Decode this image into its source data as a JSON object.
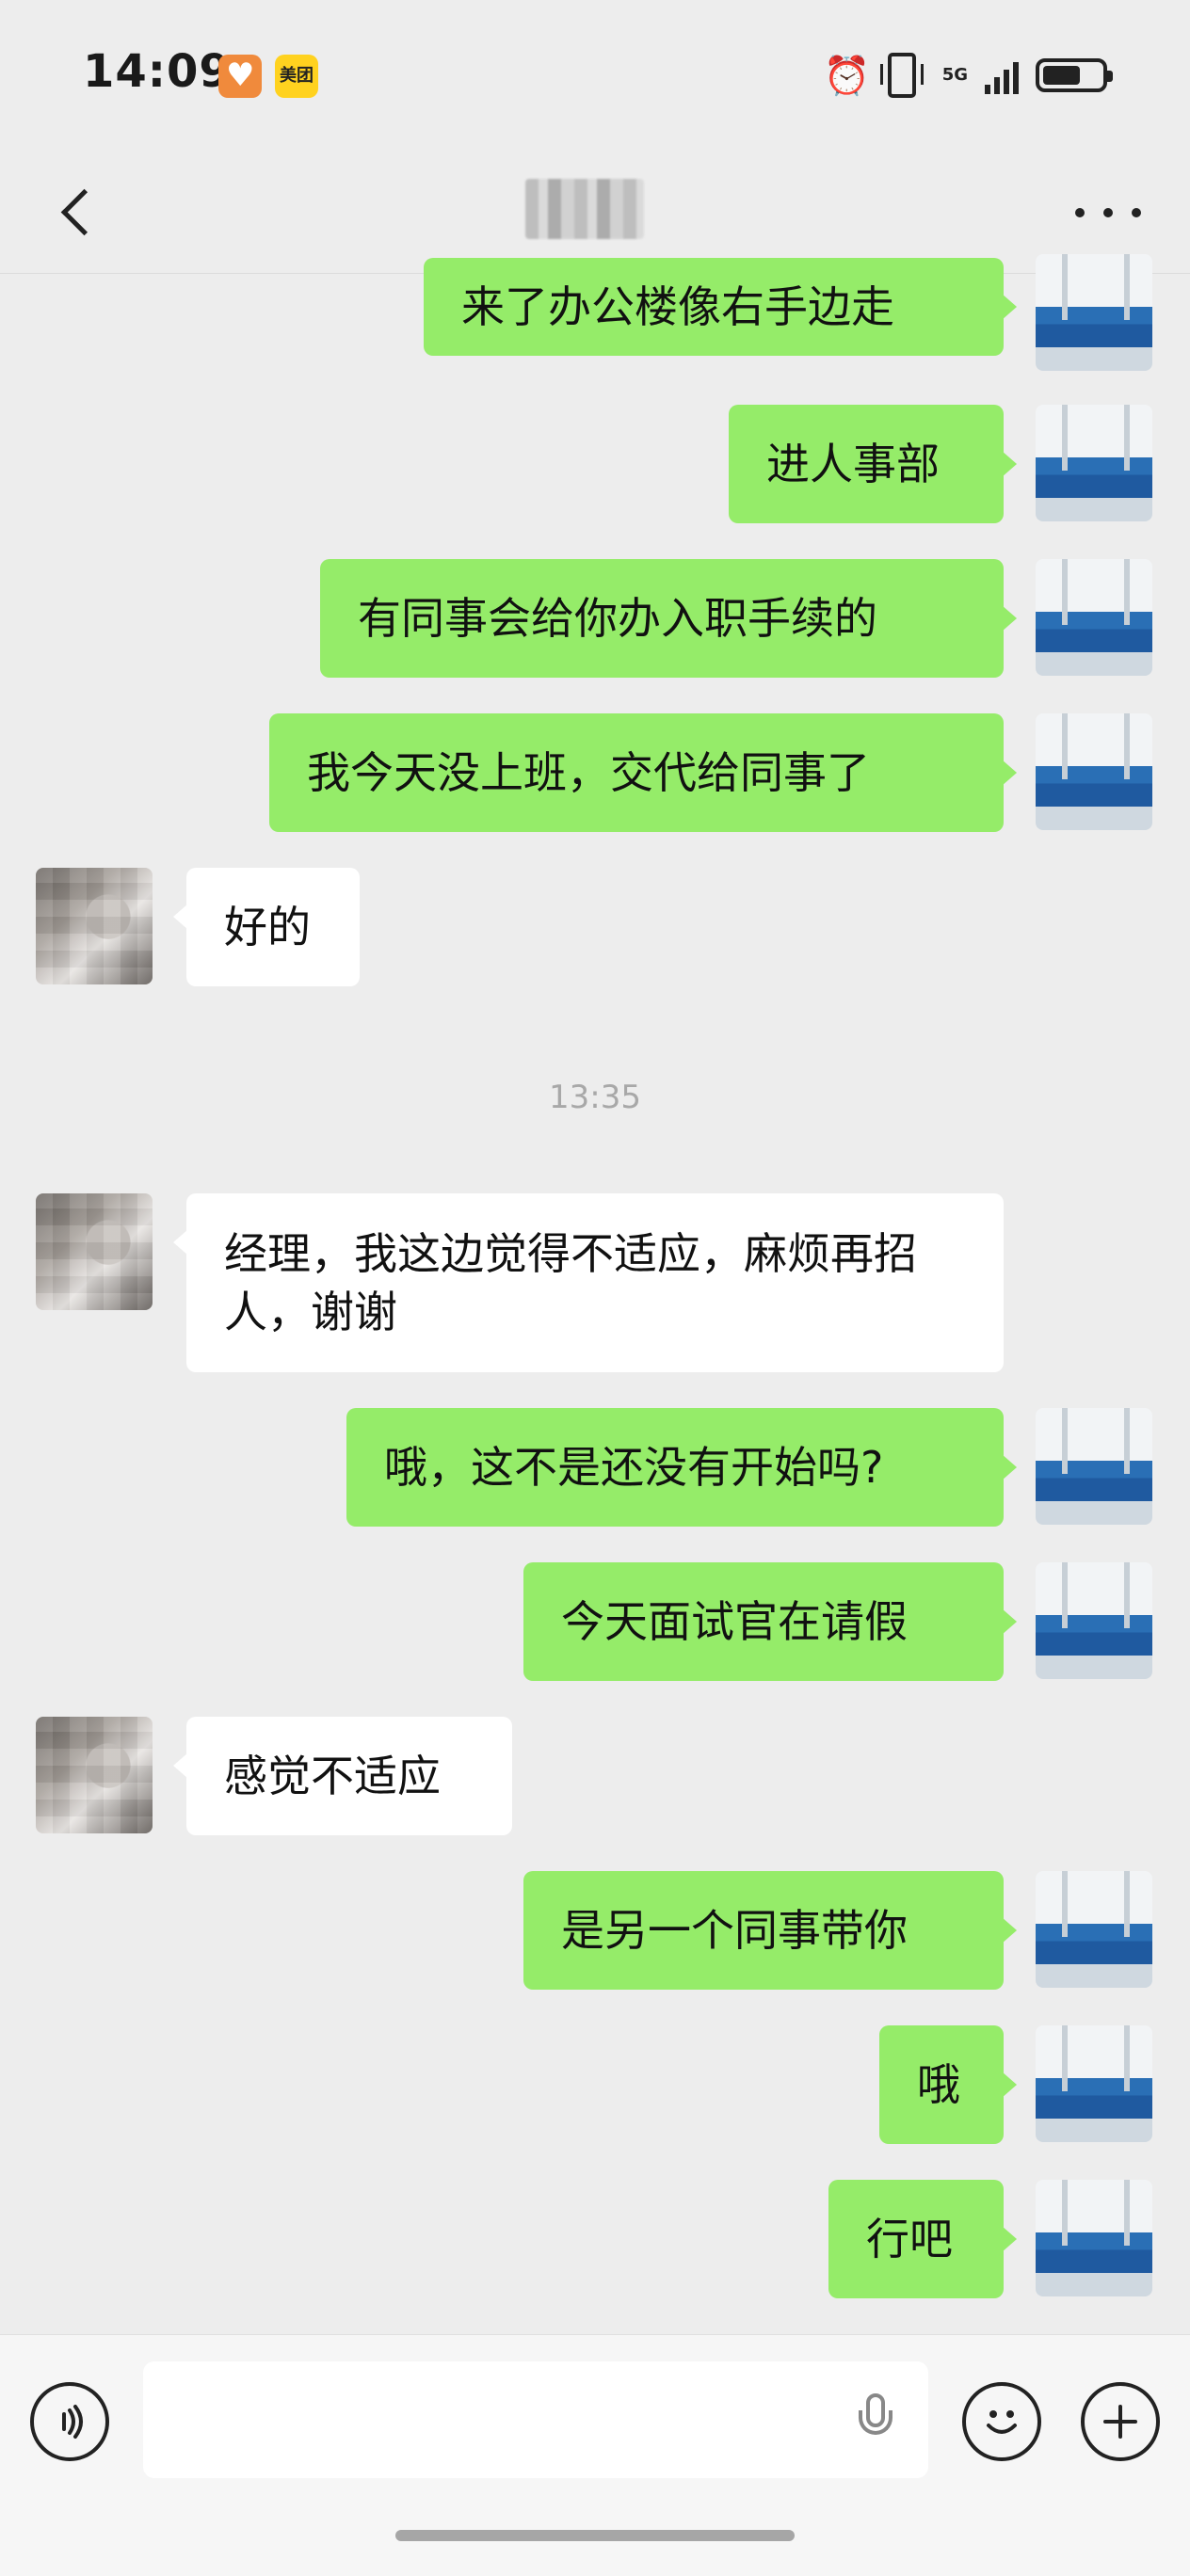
{
  "status_bar": {
    "time": "14:09",
    "meituan_label": "美团",
    "network": "5G"
  },
  "header": {
    "title_obscured": "张**"
  },
  "messages": [
    {
      "side": "me",
      "text": "来了办公楼像右手边走"
    },
    {
      "side": "me",
      "text": "进人事部"
    },
    {
      "side": "me",
      "text": "有同事会给你办入职手续的"
    },
    {
      "side": "me",
      "text": "我今天没上班，交代给同事了"
    },
    {
      "side": "them",
      "text": "好的"
    },
    {
      "side": "them",
      "text": "经理，我这边觉得不适应，麻烦再招人，谢谢"
    },
    {
      "side": "me",
      "text": "哦，这不是还没有开始吗?"
    },
    {
      "side": "me",
      "text": "今天面试官在请假"
    },
    {
      "side": "them",
      "text": "感觉不适应"
    },
    {
      "side": "me",
      "text": "是另一个同事带你"
    },
    {
      "side": "me",
      "text": "哦"
    },
    {
      "side": "me",
      "text": "行吧"
    }
  ],
  "timestamp": "13:35",
  "input": {
    "placeholder": "",
    "value": ""
  },
  "colors": {
    "background": "#ededed",
    "my_bubble": "#95ec69",
    "their_bubble": "#ffffff",
    "timestamp": "#a8a8a8"
  },
  "icons": [
    "back-arrow-icon",
    "more-icon",
    "voice-icon",
    "microphone-icon",
    "emoji-icon",
    "plus-icon",
    "alarm-icon",
    "vibrate-icon",
    "signal-icon",
    "battery-icon"
  ]
}
